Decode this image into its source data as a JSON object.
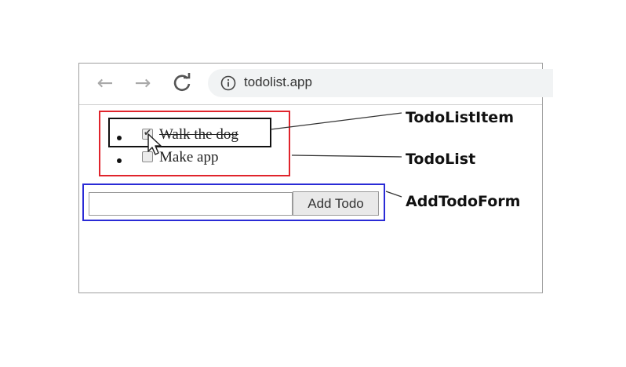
{
  "browser": {
    "url": "todolist.app"
  },
  "todo_items": [
    {
      "text": "Walk the dog",
      "checked": true
    },
    {
      "text": "Make app",
      "checked": false
    }
  ],
  "form": {
    "input_value": "",
    "button_label": "Add Todo"
  },
  "annotations": {
    "todo_list_item": "TodoListItem",
    "todo_list": "TodoList",
    "add_todo_form": "AddTodoForm"
  },
  "colors": {
    "todo_list_outline": "#e0242c",
    "todo_list_item_outline": "#111111",
    "add_todo_form_outline": "#2a2bd6"
  }
}
